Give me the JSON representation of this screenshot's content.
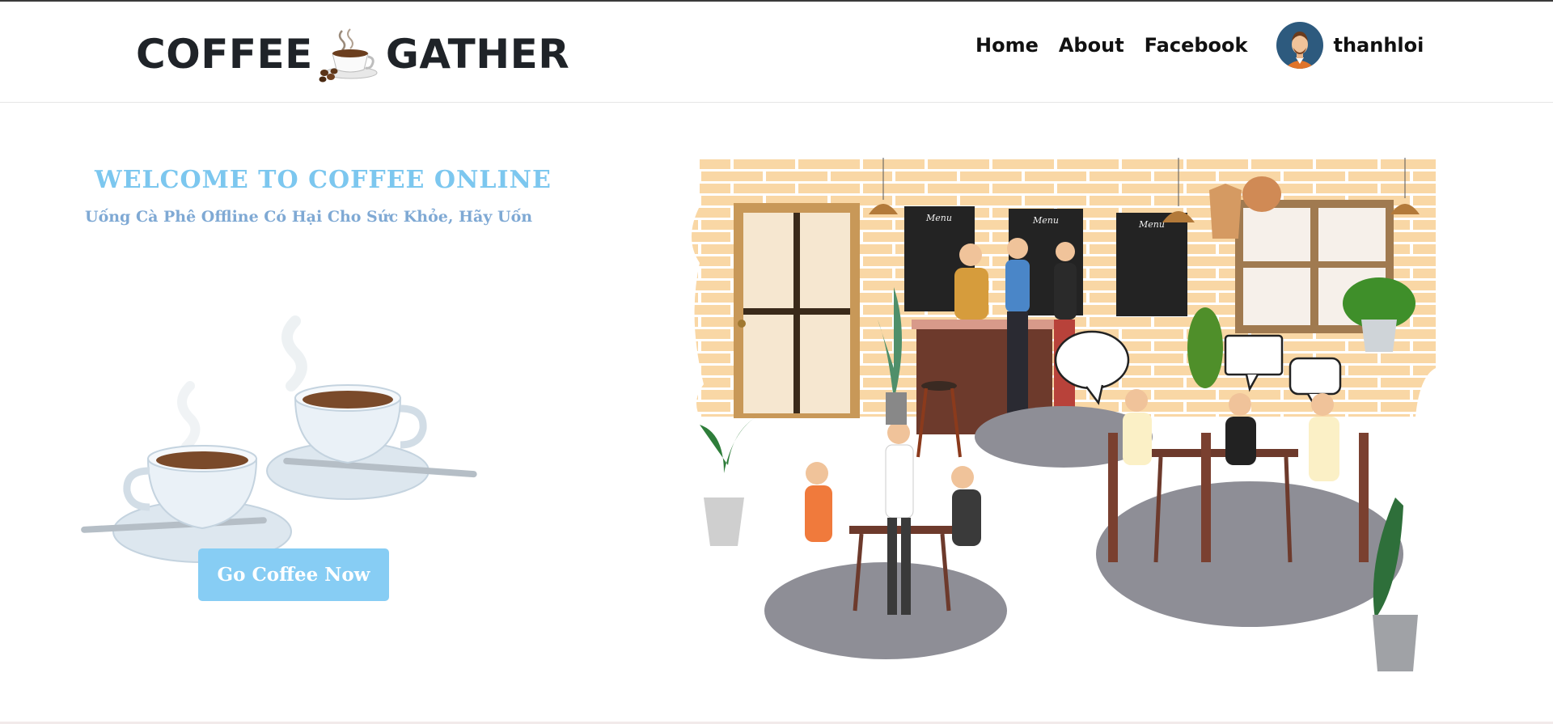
{
  "header": {
    "logo_left": "COFFEE",
    "logo_right": "GATHER",
    "nav": [
      {
        "label": "Home"
      },
      {
        "label": "About"
      },
      {
        "label": "Facebook"
      }
    ],
    "user": {
      "name": "thanhloi"
    }
  },
  "hero": {
    "welcome": "WELCOME TO COFFEE ONLINE",
    "tagline": "Uống Cà Phê Offline Có Hại Cho Sức Khỏe, Hãy Uốn",
    "cta": "Go Coffee Now"
  },
  "scene": {
    "menu_boards": [
      "Menu",
      "Menu",
      "Menu"
    ]
  },
  "colors": {
    "accent_blue": "#87cdf4",
    "welcome_blue": "#7cc7ef",
    "text_dark": "#1f2328",
    "wall_brick": "#f9d7a5"
  }
}
